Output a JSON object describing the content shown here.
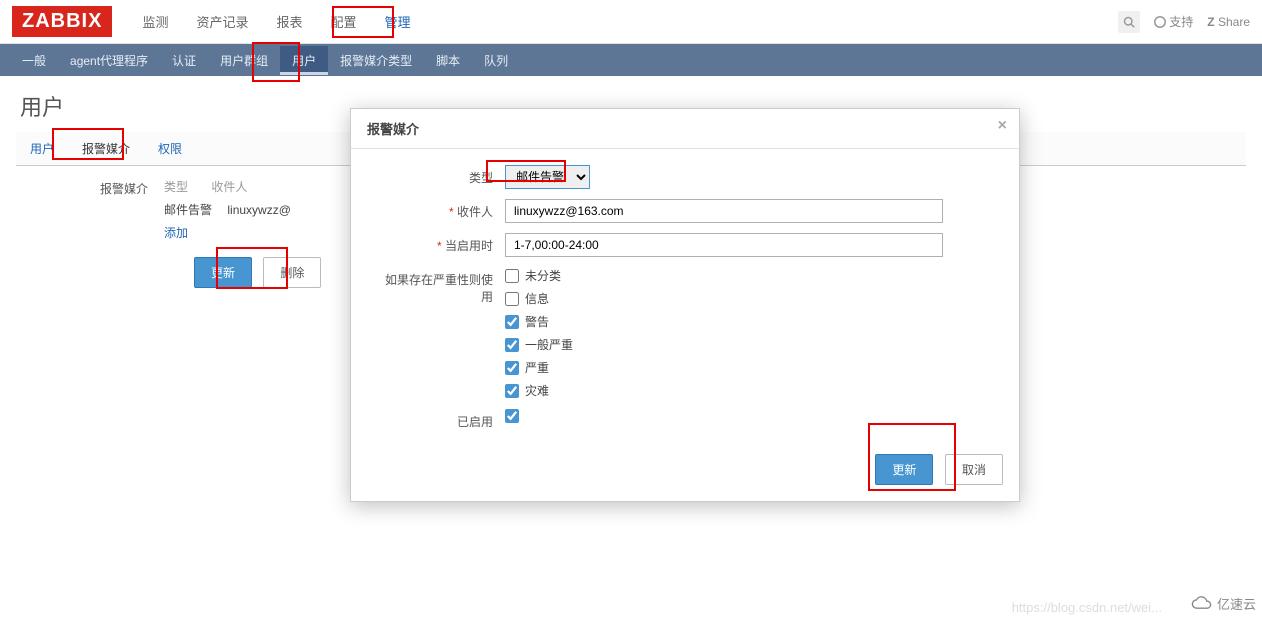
{
  "brand": "ZABBIX",
  "topnav": {
    "items": [
      "监测",
      "资产记录",
      "报表",
      "配置",
      "管理"
    ],
    "active_index": 4
  },
  "topRight": {
    "support": "支持",
    "share": "Share",
    "share_prefix": "Z"
  },
  "subnav": {
    "items": [
      "一般",
      "agent代理程序",
      "认证",
      "用户群组",
      "用户",
      "报警媒介类型",
      "脚本",
      "队列"
    ],
    "active_index": 4
  },
  "page": {
    "title": "用户"
  },
  "tabs": {
    "items": [
      "用户",
      "报警媒介",
      "权限"
    ],
    "active_index": 1
  },
  "userForm": {
    "section_label": "报警媒介",
    "colType": "类型",
    "colRecipient": "收件人",
    "typeVal": "邮件告警",
    "recipientVal": "linuxywzz@",
    "addLink": "添加",
    "updateBtn": "更新",
    "deleteBtn": "删除"
  },
  "modal": {
    "title": "报警媒介",
    "type_label": "类型",
    "type_value": "邮件告警",
    "recipient_label": "收件人",
    "recipient_required": "*",
    "recipient_value": "linuxywzz@163.com",
    "whenActive_label": "当启用时",
    "whenActive_required": "*",
    "whenActive_value": "1-7,00:00-24:00",
    "severity_label": "如果存在严重性则使用",
    "severities": [
      {
        "label": "未分类",
        "checked": false
      },
      {
        "label": "信息",
        "checked": false
      },
      {
        "label": "警告",
        "checked": true
      },
      {
        "label": "一般严重",
        "checked": true
      },
      {
        "label": "严重",
        "checked": true
      },
      {
        "label": "灾难",
        "checked": true
      }
    ],
    "enabled_label": "已启用",
    "enabled_checked": true,
    "updateBtn": "更新",
    "cancelBtn": "取消"
  },
  "watermark1": "https://blog.csdn.net/wei...",
  "watermark2": "亿速云"
}
